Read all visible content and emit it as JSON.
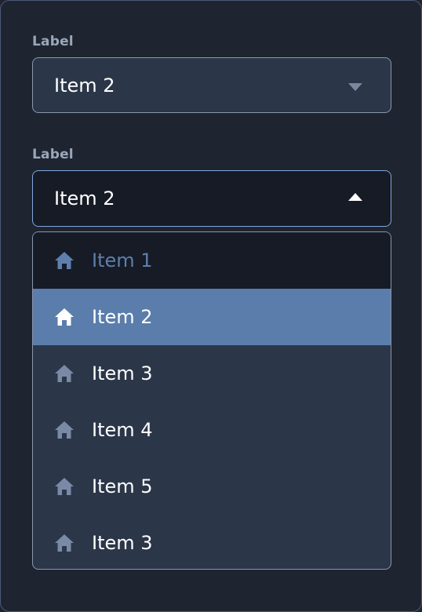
{
  "fields": [
    {
      "label": "Label",
      "value": "Item 2",
      "state": "closed"
    },
    {
      "label": "Label",
      "value": "Item 2",
      "state": "open"
    }
  ],
  "menu": {
    "items": [
      {
        "label": "Item 1",
        "icon": "home-icon",
        "state": "hovered"
      },
      {
        "label": "Item 2",
        "icon": "home-icon",
        "state": "selected"
      },
      {
        "label": "Item 3",
        "icon": "home-icon",
        "state": "default"
      },
      {
        "label": "Item 4",
        "icon": "home-icon",
        "state": "default"
      },
      {
        "label": "Item 5",
        "icon": "home-icon",
        "state": "default"
      },
      {
        "label": "Item 3",
        "icon": "home-icon",
        "state": "default"
      }
    ]
  },
  "colors": {
    "background": "#1f2530",
    "field_bg": "#2b3649",
    "open_field_bg": "#161b25",
    "focus_border": "#7fa6dd",
    "selected_bg": "#5a7dab",
    "label_text": "#9aa6bb"
  }
}
